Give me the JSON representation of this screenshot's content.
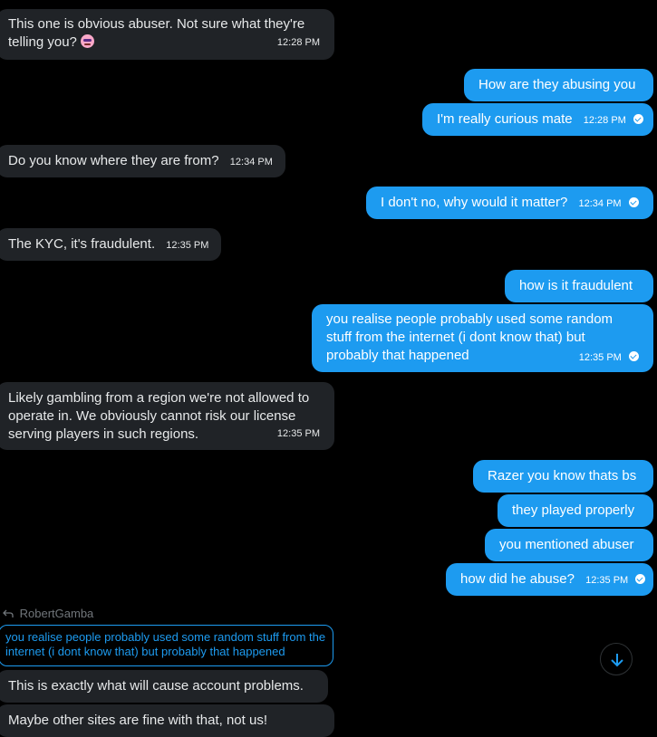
{
  "messages": [
    {
      "text": "This one is obvious abuser. Not sure what they're telling you?",
      "time": "12:28 PM"
    },
    {
      "text": "How are they abusing you"
    },
    {
      "text": "I'm really curious mate",
      "time": "12:28 PM"
    },
    {
      "text": "Do you know where they are from?",
      "time": "12:34 PM"
    },
    {
      "text": "I don't no, why would it matter?",
      "time": "12:34 PM"
    },
    {
      "text": "The KYC, it's fraudulent.",
      "time": "12:35 PM"
    },
    {
      "text": "how is it fraudulent"
    },
    {
      "text": "you realise people probably used some random stuff from the internet (i dont know that) but probably that happened",
      "time": "12:35 PM"
    },
    {
      "text": "Likely gambling from a region we're not allowed to operate in. We obviously cannot risk our license serving players in such regions.",
      "time": "12:35 PM"
    },
    {
      "text": "Razer you know thats bs"
    },
    {
      "text": "they played properly"
    },
    {
      "text": "you mentioned abuser"
    },
    {
      "text": "how did he abuse?",
      "time": "12:35 PM"
    },
    {
      "text": "This is exactly what will cause account problems."
    },
    {
      "text": "Maybe other sites are fine with that, not us!"
    }
  ],
  "reply": {
    "author": "RobertGamba",
    "quoted": "you realise people probably used some random stuff from the internet (i dont know that) but probably that happened"
  },
  "icons": {
    "reply": "reply-arrow-icon",
    "scroll": "arrow-down-icon",
    "read": "check-circle-icon"
  },
  "colors": {
    "outgoing": "#1d9bf0",
    "incoming": "#202327",
    "background": "#000000"
  }
}
